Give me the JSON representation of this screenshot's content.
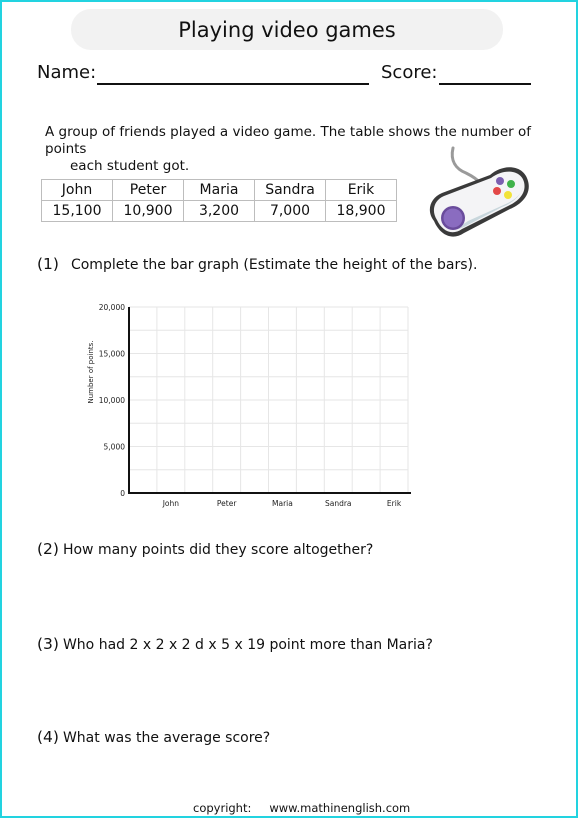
{
  "worksheet": {
    "title": "Playing video games",
    "name_label": "Name:",
    "score_label": "Score:",
    "intro_line1": "A group of friends played a video game. The table shows the number of points",
    "intro_line2": "each student got.",
    "table": {
      "headers": [
        "John",
        "Peter",
        "Maria",
        "Sandra",
        "Erik"
      ],
      "values": [
        "15,100",
        "10,900",
        "3,200",
        "7,000",
        "18,900"
      ]
    },
    "illustration": "gamepad-icon",
    "questions": [
      {
        "number": "(1)",
        "text": "Complete the bar graph (Estimate the height of the bars)."
      },
      {
        "number": "(2)",
        "text": "How many points did they score altogether?"
      },
      {
        "number": "(3)",
        "text": "Who had 2 x 2 x 2 d x 5 x 19 point more than Maria?"
      },
      {
        "number": "(4)",
        "text": "What was the average score?"
      }
    ],
    "footer": {
      "copyright_label": "copyright:",
      "url": "www.mathinenglish.com"
    },
    "colors": {
      "border": "#22d3e0",
      "title_bg": "#f2f2f2",
      "grid": "#e6e6e6"
    }
  },
  "chart_data": {
    "type": "bar",
    "title": "",
    "xlabel": "",
    "ylabel": "Number of points.",
    "categories": [
      "John",
      "Peter",
      "Maria",
      "Sandra",
      "Erik"
    ],
    "values": [
      null,
      null,
      null,
      null,
      null
    ],
    "ylim": [
      0,
      20000
    ],
    "yticks": [
      0,
      5000,
      10000,
      15000,
      20000
    ],
    "ytick_labels": [
      "0",
      "5,000",
      "10,000",
      "15,000",
      "20,000"
    ],
    "grid_step": 2500,
    "grid": true,
    "note": "Empty bar graph to be completed by student"
  }
}
